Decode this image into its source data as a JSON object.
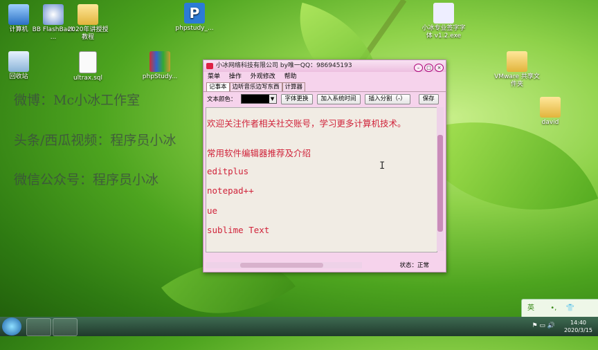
{
  "desktop": {
    "icons": [
      {
        "label": "计算机"
      },
      {
        "label": "BB FlashBack ..."
      },
      {
        "label": "2020年讲授授教程"
      },
      {
        "label": "phpstudy_..."
      },
      {
        "label": "小冰专业签字字体 v1.2.exe"
      },
      {
        "label": "回收站"
      },
      {
        "label": "ultrax.sql"
      },
      {
        "label": "phpStudy..."
      },
      {
        "label": "VMware 共享文件夹"
      },
      {
        "label": "david"
      }
    ]
  },
  "overlay": {
    "weibo": "微博：Mc小冰工作室",
    "toutiao": "头条/西瓜视频：程序员小冰",
    "wechat": "微信公众号：程序员小冰"
  },
  "window": {
    "title": "小冰网络科技有限公司 by唯一QQ：986945193",
    "menus": [
      "菜单",
      "操作",
      "外观修改",
      "帮助"
    ],
    "tabs": [
      "记事本",
      "边听音乐边写东西",
      "计算器"
    ],
    "toolbar": {
      "color_label": "文本颜色：",
      "font_button": "字体更换",
      "time_button": "加入系统时间",
      "split_button": "插入分割（-）",
      "save_button": "保存"
    },
    "editor_lines": [
      "欢迎关注作者相关社交账号，学习更多计算机技术。",
      "常用软件编辑器推荐及介绍",
      "editplus",
      "notepad++",
      "ue",
      "sublime Text"
    ],
    "status": "状态：正常"
  },
  "ime": {
    "label": "英"
  },
  "taskbar": {
    "time": "14:40",
    "date": "2020/3/15"
  },
  "colors": {
    "editor_text": "#d0233a",
    "window_bg": "#f6d3ec"
  }
}
